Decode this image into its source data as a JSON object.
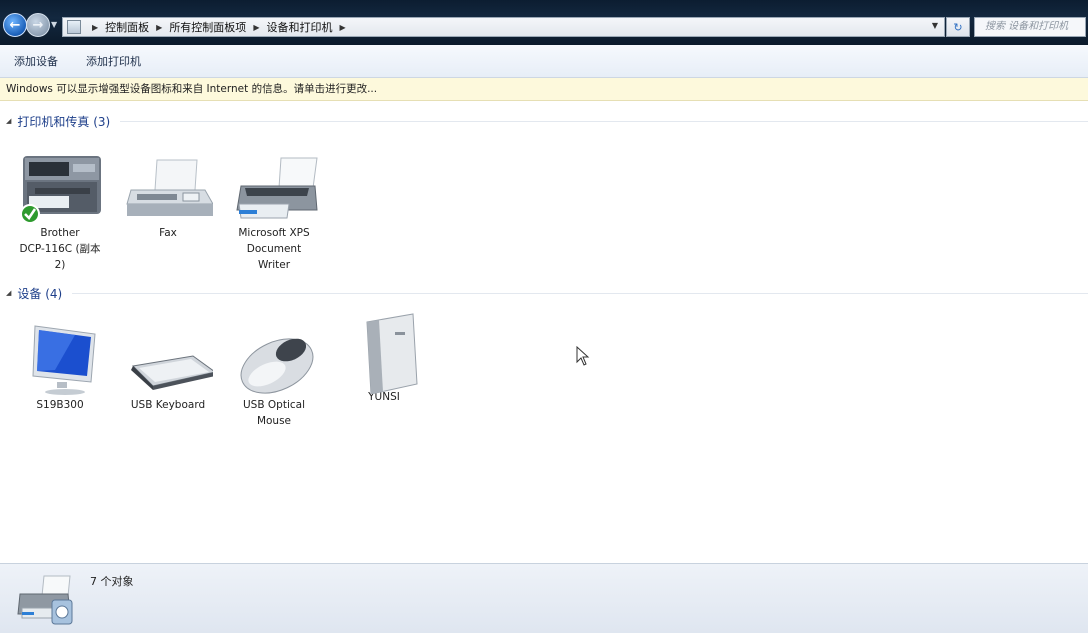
{
  "address_bar": {
    "breadcrumbs": [
      "控制面板",
      "所有控制面板项",
      "设备和打印机"
    ],
    "search_placeholder": "搜索 设备和打印机"
  },
  "command_bar": {
    "add_device": "添加设备",
    "add_printer": "添加打印机"
  },
  "info_bar": {
    "text": "Windows 可以显示增强型设备图标和来自 Internet 的信息。请单击进行更改..."
  },
  "groups": {
    "printers": {
      "label": "打印机和传真 (3)",
      "items": [
        {
          "name": "Brother\nDCP-116C (副本\n2)",
          "icon": "printer-default-icon"
        },
        {
          "name": "Fax",
          "icon": "fax-icon"
        },
        {
          "name": "Microsoft XPS\nDocument\nWriter",
          "icon": "printer-icon"
        }
      ]
    },
    "devices": {
      "label": "设备 (4)",
      "items": [
        {
          "name": "S19B300",
          "icon": "monitor-icon"
        },
        {
          "name": "USB Keyboard",
          "icon": "keyboard-icon"
        },
        {
          "name": "USB Optical\nMouse",
          "icon": "mouse-icon"
        },
        {
          "name": "YUNSI",
          "icon": "computer-icon"
        }
      ]
    }
  },
  "details_pane": {
    "count": "7 个对象"
  }
}
